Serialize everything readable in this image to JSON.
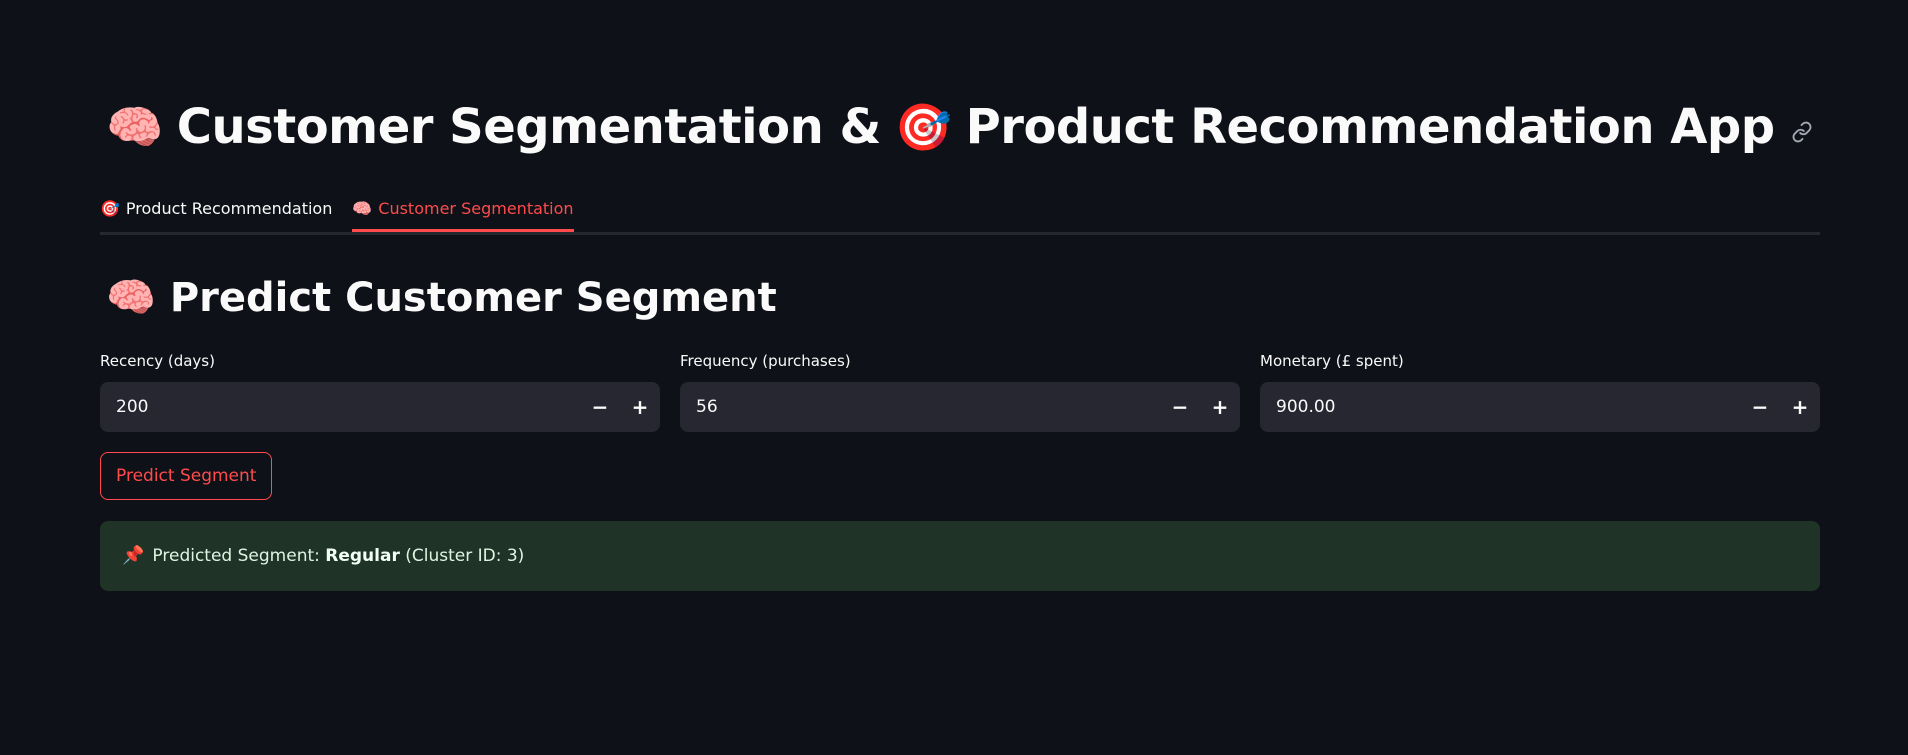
{
  "header": {
    "title_emoji_1": "🧠",
    "title_part_1": "Customer Segmentation &",
    "title_emoji_2": "🎯",
    "title_part_2": "Product Recommendation App"
  },
  "tabs": [
    {
      "emoji": "🎯",
      "label": "Product Recommendation",
      "active": false
    },
    {
      "emoji": "🧠",
      "label": "Customer Segmentation",
      "active": true
    }
  ],
  "section": {
    "emoji": "🧠",
    "title": "Predict Customer Segment"
  },
  "inputs": [
    {
      "label": "Recency (days)",
      "value": "200"
    },
    {
      "label": "Frequency (purchases)",
      "value": "56"
    },
    {
      "label": "Monetary (£ spent)",
      "value": "900.00"
    }
  ],
  "stepper": {
    "minus": "−",
    "plus": "+"
  },
  "predict_button": {
    "label": "Predict Segment"
  },
  "result": {
    "emoji": "📌",
    "prefix": "Predicted Segment:",
    "segment": "Regular",
    "suffix": "(Cluster ID: 3)"
  },
  "colors": {
    "background": "#0e1117",
    "accent": "#ff4b4b",
    "input_bg": "#262730",
    "success_bg": "#1f3327"
  }
}
